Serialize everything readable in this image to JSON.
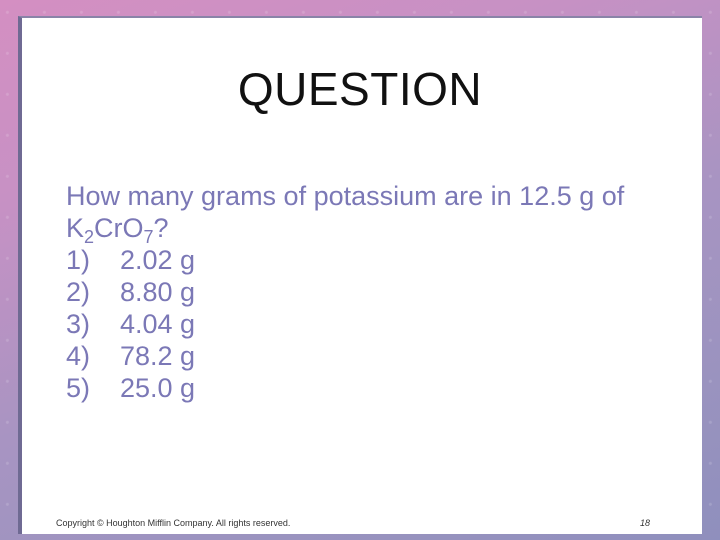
{
  "slide": {
    "title": "QUESTION",
    "question_line1": "How many grams of potassium are in 12.5 g of",
    "formula": {
      "part1": "K",
      "sub1": "2",
      "part2": "CrO",
      "sub2": "7",
      "end": "?"
    },
    "options": [
      {
        "num": "1)",
        "value": "2.02 g"
      },
      {
        "num": "2)",
        "value": "8.80 g"
      },
      {
        "num": "3)",
        "value": "4.04 g"
      },
      {
        "num": "4)",
        "value": "78.2 g"
      },
      {
        "num": "5)",
        "value": "25.0 g"
      }
    ],
    "footer": {
      "copyright": "Copyright © Houghton Mifflin Company. All rights reserved.",
      "page_number": "18"
    }
  },
  "colors": {
    "question_text": "#7b78b6",
    "title_text": "#111111",
    "background": "#c791c4"
  }
}
